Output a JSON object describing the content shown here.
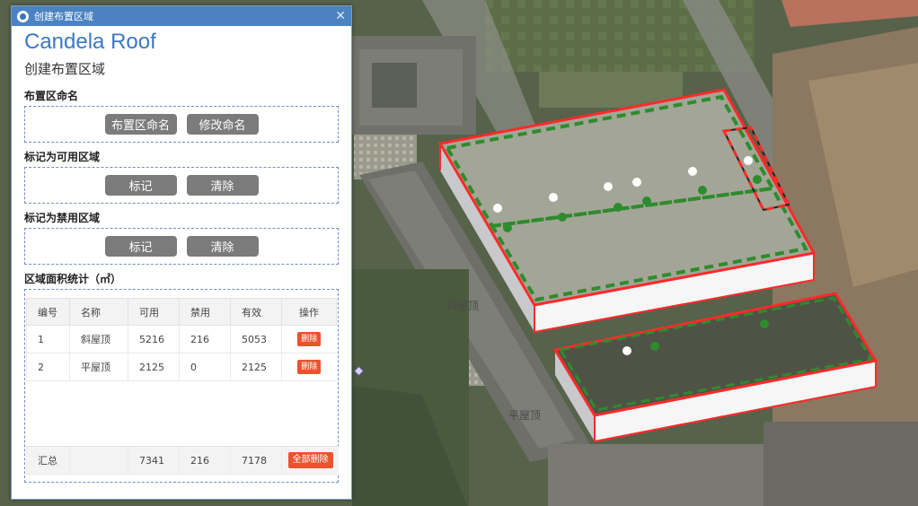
{
  "window": {
    "title": "创建布置区域"
  },
  "header": {
    "brand": "Candela Roof",
    "subtitle": "创建布置区域"
  },
  "naming": {
    "label": "布置区命名",
    "name_button": "布置区命名",
    "rename_button": "修改命名"
  },
  "usable": {
    "label": "标记为可用区域",
    "mark_button": "标记",
    "clear_button": "清除"
  },
  "forbidden": {
    "label": "标记为禁用区域",
    "mark_button": "标记",
    "clear_button": "清除"
  },
  "stats": {
    "label": "区域面积统计（㎡）",
    "columns": [
      "编号",
      "名称",
      "可用",
      "禁用",
      "有效",
      "操作"
    ],
    "rows": [
      {
        "id": "1",
        "name": "斜屋顶",
        "usable": "5216",
        "forbidden": "216",
        "effective": "5053",
        "action": "删除"
      },
      {
        "id": "2",
        "name": "平屋顶",
        "usable": "2125",
        "forbidden": "0",
        "effective": "2125",
        "action": "删除"
      }
    ],
    "total": {
      "label": "汇总",
      "usable": "7341",
      "forbidden": "216",
      "effective": "7178",
      "action": "全部删除"
    }
  },
  "map": {
    "labels": {
      "building1": "斜屋顶",
      "building2": "平屋顶"
    },
    "colors": {
      "boundary": "#ff2a2a",
      "usable_zone": "#2e8b2e"
    }
  }
}
